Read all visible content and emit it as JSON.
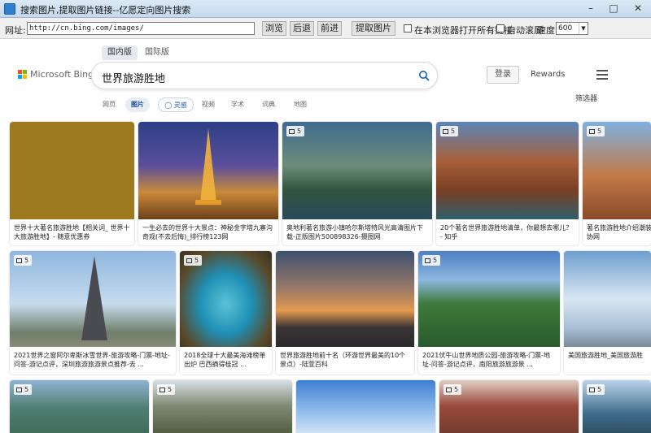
{
  "window": {
    "title": "搜索图片,提取图片链接--亿愿定向图片搜索"
  },
  "toolbar": {
    "url_label": "网址:",
    "url_value": "http://cn.bing.com/images/",
    "browse": "浏览",
    "back": "后退",
    "forward": "前进",
    "extract": "提取图片",
    "open_all_label": "在本浏览器打开所有链接",
    "auto_scroll_label": "自动滚屏",
    "speed_label": "速度:",
    "speed_value": "600"
  },
  "bing": {
    "scope_tabs": [
      "国内版",
      "国际版"
    ],
    "logo_text": "Microsoft Bing",
    "query": "世界旅游胜地",
    "login": "登录",
    "rewards": "Rewards",
    "nav_tabs": [
      "网页",
      "图片",
      "灵感",
      "视频",
      "学术",
      "词典",
      "地图"
    ],
    "filter": "筛选器"
  },
  "images": [
    {
      "caption": "世界十大著名旅游胜地【相关词_ 世界十大旅游胜地】- 随意优惠券",
      "badge": ""
    },
    {
      "caption": "一生必去的世界十大景点：神秘金字塔九寨沟奇观(不去后悔)_排行榜123网",
      "badge": ""
    },
    {
      "caption": "奥地利著名旅游小镇哈尔斯塔特风光高清图片下载-正版图片500898326-摄图网",
      "badge": "5"
    },
    {
      "caption": "20个著名世界旅游胜地清单，你最想去哪儿？ - 知乎",
      "badge": "5"
    },
    {
      "caption": "著名旅游胜地介绍潮装协网",
      "badge": "5"
    },
    {
      "caption": "2021世界之窗阿尔卑斯冰雪世界-旅游攻略-门票-地址-问答-游记点评，深圳旅游旅游景点推荐-去 ...",
      "badge": "5"
    },
    {
      "caption": "2018全球十大最美海滩榜单出炉 巴西摘得桂冠 ...",
      "badge": "5"
    },
    {
      "caption": "世界旅游胜地前十名（环游世界最美的10个景点）-陆萱百科",
      "badge": ""
    },
    {
      "caption": "2021伏牛山世界地质公园-旅游攻略-门票-地址-问答-游记点评，南阳旅游旅游景 ...",
      "badge": "5"
    },
    {
      "caption": "美国旅游胜地_美国旅游胜",
      "badge": ""
    },
    {
      "caption": "",
      "badge": "5"
    },
    {
      "caption": "",
      "badge": "5"
    },
    {
      "caption": "",
      "badge": ""
    },
    {
      "caption": "",
      "badge": "5"
    },
    {
      "caption": "",
      "badge": "5"
    }
  ]
}
